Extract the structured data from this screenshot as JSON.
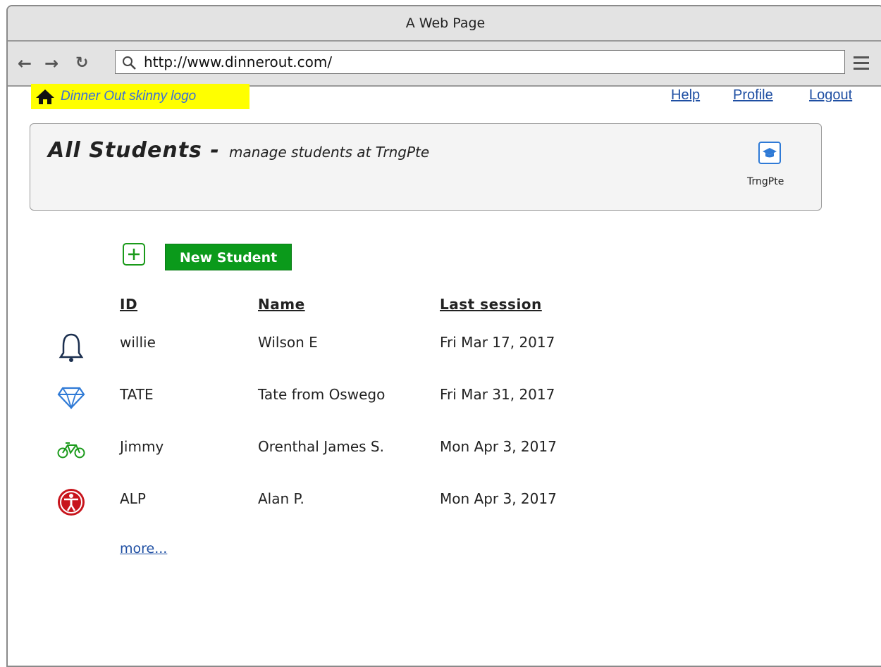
{
  "browser": {
    "window_title": "A Web Page",
    "url": "http://www.dinnerout.com/"
  },
  "app": {
    "logo_text": "Dinner Out skinny logo",
    "nav_links": [
      "Help",
      "Profile",
      "Logout"
    ]
  },
  "header": {
    "title": "All Students -",
    "subtitle": "manage students at TrngPte",
    "org_label": "TrngPte"
  },
  "actions": {
    "new_student_label": "New Student"
  },
  "table": {
    "columns": [
      "ID",
      "Name",
      "Last session"
    ],
    "rows": [
      {
        "icon": "bell-icon",
        "id": "willie",
        "name": "Wilson E",
        "last_session": "Fri Mar 17, 2017"
      },
      {
        "icon": "diamond-icon",
        "id": "TATE",
        "name": "Tate from Oswego",
        "last_session": "Fri Mar 31, 2017"
      },
      {
        "icon": "bicycle-icon",
        "id": "Jimmy",
        "name": "Orenthal James S.",
        "last_session": "Mon Apr 3, 2017"
      },
      {
        "icon": "universal-access-icon",
        "id": "ALP",
        "name": "Alan P.",
        "last_session": "Mon Apr 3, 2017"
      }
    ],
    "more_label": "more..."
  },
  "colors": {
    "logo_bg": "#ffff00",
    "link": "#1f4fa3",
    "primary_button": "#0b9a1b",
    "org_icon": "#2f7ad6",
    "bell": "#1b2f4f",
    "diamond": "#2f7ad6",
    "bicycle": "#1a9a1a",
    "access": "#c8141c"
  }
}
